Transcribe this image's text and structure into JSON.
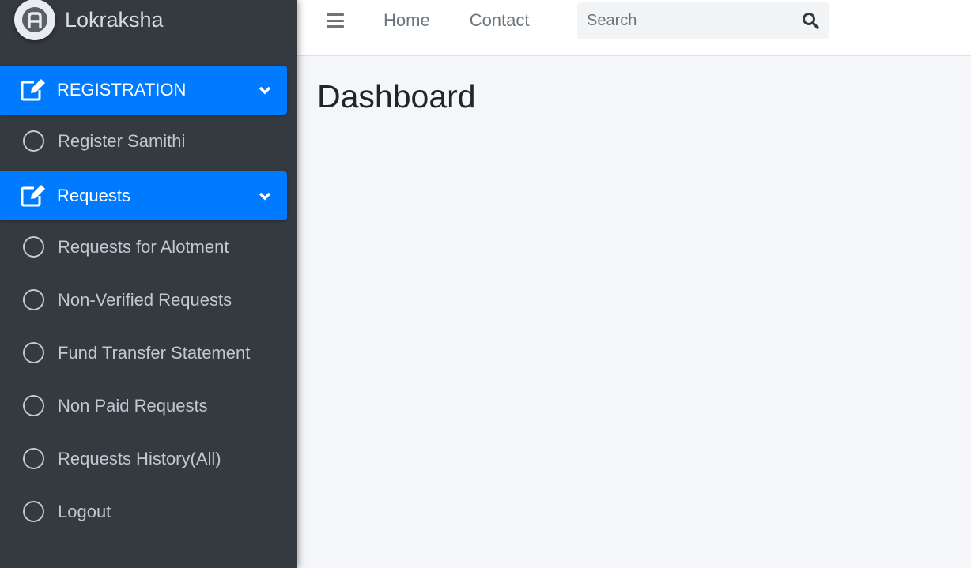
{
  "brand": {
    "name": "Lokraksha"
  },
  "topbar": {
    "home_label": "Home",
    "contact_label": "Contact",
    "search_placeholder": "Search"
  },
  "sidebar": {
    "sections": [
      {
        "header": "REGISTRATION",
        "items": [
          "Register Samithi"
        ]
      },
      {
        "header": "Requests",
        "items": [
          "Requests for Alotment",
          "Non-Verified Requests",
          "Fund Transfer Statement",
          "Non Paid Requests",
          "Requests History(All)",
          "Logout"
        ]
      }
    ]
  },
  "main": {
    "title": "Dashboard"
  },
  "colors": {
    "sidebar_bg": "#343a40",
    "accent": "#007bff",
    "content_bg": "#f4f6f9"
  },
  "icons": {
    "brand": "brand-logo-icon",
    "section": "edit-icon",
    "toggle": "chevron-down-icon",
    "item": "circle-icon",
    "menu": "hamburger-icon",
    "search": "search-icon"
  }
}
